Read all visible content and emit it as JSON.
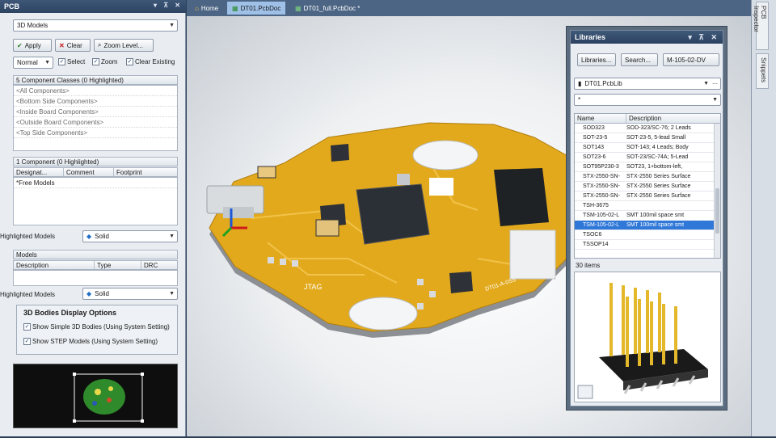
{
  "pcb_panel": {
    "title": "PCB",
    "mode": "3D Models",
    "apply": "Apply",
    "clear": "Clear",
    "zoom_level": "Zoom Level...",
    "filter_mode": "Normal",
    "select": "Select",
    "zoom": "Zoom",
    "clear_existing": "Clear Existing",
    "classes_header": "5 Component Classes (0 Highlighted)",
    "classes": [
      "<All Components>",
      "<Bottom Side Components>",
      "<Inside Board Components>",
      "<Outside Board Components>",
      "<Top Side Components>"
    ],
    "components_header": "1 Component (0 Highlighted)",
    "component_cols": [
      "Designat...",
      "Comment",
      "Footprint"
    ],
    "components": [
      "*Free Models"
    ],
    "highlighted_models_label_1": "Highlighted Models",
    "highlighted_models_value_1": "Solid",
    "models_label": "Models",
    "model_cols": [
      "Description",
      "Type",
      "DRC"
    ],
    "highlighted_models_label_2": "Highlighted Models",
    "highlighted_models_value_2": "Solid",
    "bodies_title": "3D Bodies Display Options",
    "show_simple": "Show Simple 3D Bodies (Using System Setting)",
    "show_step": "Show STEP Models (Using System Setting)"
  },
  "tabs": [
    {
      "label": "Home",
      "active": false
    },
    {
      "label": "DT01.PcbDoc",
      "active": true
    },
    {
      "label": "DT01_full.PcbDoc *",
      "active": false
    }
  ],
  "board_labels": {
    "jtag": "JTAG",
    "badge": "DT01-A-0SS\nPCB 0315"
  },
  "libraries": {
    "title": "Libraries",
    "btn_libraries": "Libraries...",
    "btn_search": "Search...",
    "btn_place": "M-105-02-DV",
    "library": "DT01.PcbLib",
    "filter": "*",
    "col_name": "Name",
    "col_desc": "Description",
    "rows": [
      {
        "name": "SOD323",
        "desc": "SOD-323/SC-76; 2 Leads"
      },
      {
        "name": "SOT-23-5",
        "desc": "SOT-23-5, 5-lead Small"
      },
      {
        "name": "SOT143",
        "desc": "SOT-143; 4 Leads; Body"
      },
      {
        "name": "SOT23-6",
        "desc": "SOT-23/SC-74A; 5-Lead"
      },
      {
        "name": "SOT95P230-3",
        "desc": "SOT23, 1+bottom-left,"
      },
      {
        "name": "STX-2550-SN-",
        "desc": "STX-2550 Series Surface"
      },
      {
        "name": "STX-2550-SN-",
        "desc": "STX-2550 Series Surface"
      },
      {
        "name": "STX-2550-SN-",
        "desc": "STX-2550 Series Surface"
      },
      {
        "name": "TSH-3675",
        "desc": ""
      },
      {
        "name": "TSM-105-02-L",
        "desc": "SMT 100mil space smt"
      },
      {
        "name": "TSM-105-02-L",
        "desc": "SMT 100mil space smt",
        "selected": true
      },
      {
        "name": "TSOC6",
        "desc": ""
      },
      {
        "name": "TSSOP14",
        "desc": ""
      }
    ],
    "count": "30 items"
  },
  "side_tabs": [
    "PCB Inspector",
    "Snippets"
  ],
  "colors": {
    "accent": "#2f78d8",
    "board": "#e2a91c",
    "title_bar": "#2d4462"
  }
}
